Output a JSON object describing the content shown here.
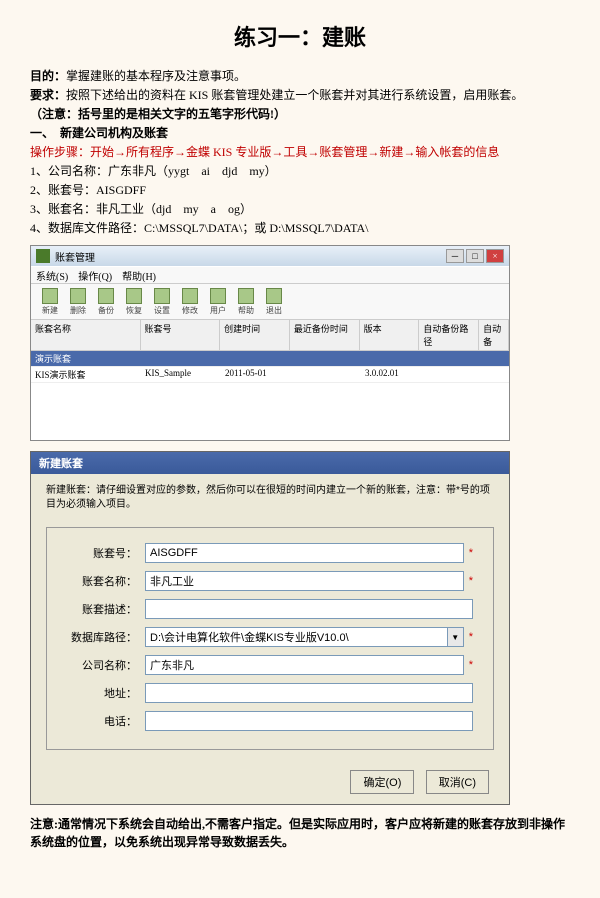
{
  "title": "练习一：建账",
  "body": {
    "purpose_label": "目的：",
    "purpose_text": "掌握建账的基本程序及注意事项。",
    "require_label": "要求：",
    "require_text": "按照下述给出的资料在 KIS 账套管理处建立一个账套并对其进行系统设置，启用账套。",
    "note": "（注意：括号里的是相关文字的五笔字形代码!）",
    "section1": "一、　新建公司机构及账套",
    "steps_red": "操作步骤：开始→所有程序→金蝶 KIS 专业版→工具→账套管理→新建→输入帐套的信息",
    "item1": "1、公司名称：广东非凡（yygt　ai　djd　my）",
    "item2": "2、账套号：AISGDFF",
    "item3": "3、账套名：非凡工业（djd　my　a　og）",
    "item4": "4、数据库文件路径：C:\\MSSQL7\\DATA\\；或 D:\\MSSQL7\\DATA\\",
    "footnote": "注意:通常情况下系统会自动给出,不需客户指定。但是实际应用时，客户应将新建的账套存放到非操作系统盘的位置，以免系统出现异常导致数据丢失。"
  },
  "win1": {
    "title": "账套管理",
    "menu": {
      "sys": "系统(S)",
      "op": "操作(Q)",
      "help": "帮助(H)"
    },
    "toolbar": {
      "b1": "新建",
      "b2": "删除",
      "b3": "备份",
      "b4": "恢复",
      "b5": "设置",
      "b6": "修改",
      "b7": "用户",
      "b8": "帮助",
      "b9": "退出"
    },
    "th": {
      "c1": "账套名称",
      "c2": "账套号",
      "c3": "创建时间",
      "c4": "最近备份时间",
      "c5": "版本",
      "c6": "自动备份路径",
      "c7": "自动备"
    },
    "r1": {
      "c1": "演示账套",
      "c2": "",
      "c3": "",
      "c4": "",
      "c5": "",
      "c6": ""
    },
    "r2": {
      "c1": "KIS演示账套",
      "c2": "KIS_Sample",
      "c3": "2011-05-01",
      "c4": "",
      "c5": "3.0.02.01",
      "c6": ""
    }
  },
  "dialog": {
    "title": "新建账套",
    "hint": "新建账套：请仔细设置对应的参数，然后你可以在很短的时间内建立一个新的账套，注意：带*号的项目为必须输入项目。",
    "labels": {
      "no": "账套号：",
      "name": "账套名称：",
      "desc": "账套描述：",
      "path": "数据库路径：",
      "company": "公司名称：",
      "addr": "地址：",
      "tel": "电话："
    },
    "values": {
      "no": "AISGDFF",
      "name": "非凡工业",
      "desc": "",
      "path": "D:\\会计电算化软件\\金蝶KIS专业版V10.0\\",
      "company": "广东非凡",
      "addr": "",
      "tel": ""
    },
    "ok": "确定(O)",
    "cancel": "取消(C)",
    "star": "*"
  }
}
